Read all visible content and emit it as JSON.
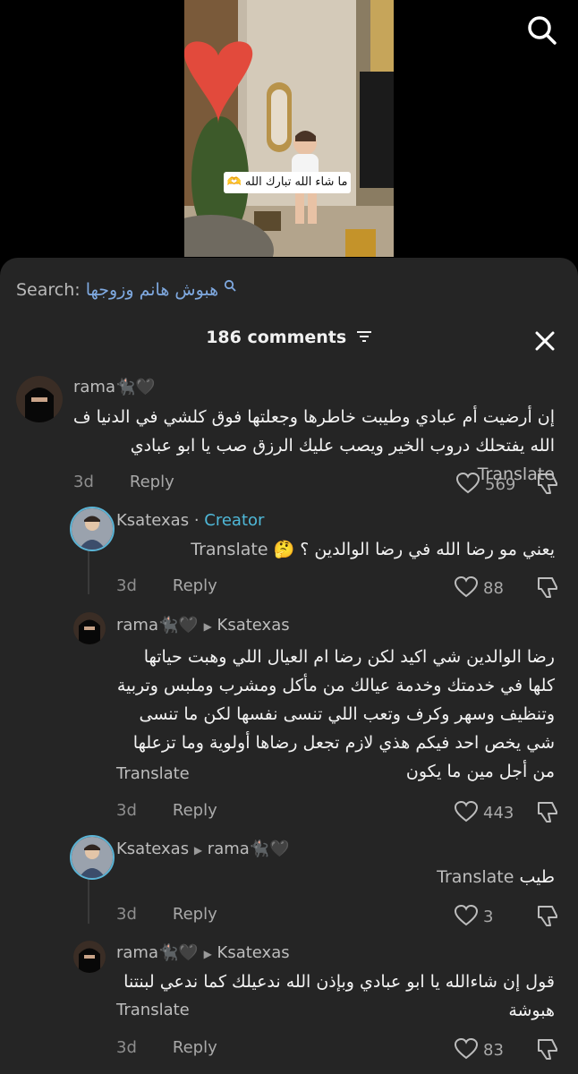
{
  "video": {
    "overlay_caption": "ما شاء الله تبارك الله 🫶"
  },
  "search": {
    "label": "Search:",
    "query": "هبوش هانم وزوجها"
  },
  "header": {
    "title": "186 comments"
  },
  "comments": [
    {
      "author": "rama🐈‍⬛🖤",
      "reply_to": "",
      "badge": "",
      "text": "إن أرضيت أم عبادي وطيبت خاطرها وجعلتها فوق كلشي في الدنيا ف الله يفتحلك دروب الخير ويصب عليك الرزق صب يا ابو عبادي",
      "translate": "Translate",
      "time": "3d",
      "reply": "Reply",
      "likes": "569"
    },
    {
      "author": "Ksatexas",
      "reply_to": "",
      "badge": "Creator",
      "text": "يعني مو رضا الله في رضا الوالدين ؟ 🤔",
      "translate": "Translate",
      "time": "3d",
      "reply": "Reply",
      "likes": "88"
    },
    {
      "author": "rama🐈‍⬛🖤",
      "reply_to": "Ksatexas",
      "badge": "",
      "text": "رضا الوالدين شي اكيد لكن رضا ام العيال اللي وهبت حياتها كلها في خدمتك وخدمة عيالك من مأكل ومشرب وملبس وتربية وتنظيف وسهر وكرف وتعب اللي تنسى نفسها لكن ما تنسى شي يخص احد فيكم هذي لازم تجعل رضاها أولوية وما تزعلها من أجل مين ما يكون",
      "translate": "Translate",
      "time": "3d",
      "reply": "Reply",
      "likes": "443"
    },
    {
      "author": "Ksatexas",
      "reply_to": "rama🐈‍⬛🖤",
      "badge": "",
      "text": "طيب",
      "translate": "Translate",
      "time": "3d",
      "reply": "Reply",
      "likes": "3"
    },
    {
      "author": "rama🐈‍⬛🖤",
      "reply_to": "Ksatexas",
      "badge": "",
      "text": "قول إن شاءالله يا ابو عبادي وبإذن الله ندعيلك كما ندعي لبنتنا هبوشة",
      "translate": "Translate",
      "time": "3d",
      "reply": "Reply",
      "likes": "83"
    }
  ]
}
